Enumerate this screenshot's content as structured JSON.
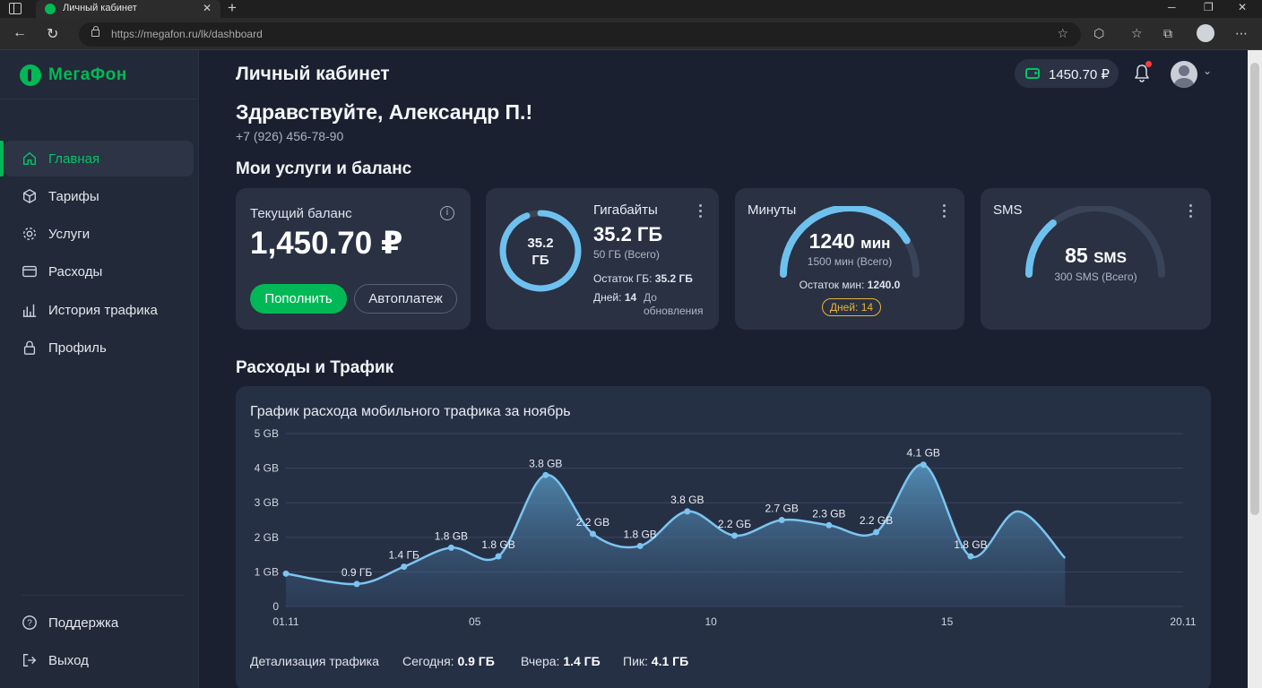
{
  "browser": {
    "tab_title": "Личный кабинет",
    "url": "https://megafon.ru/lk/dashboard"
  },
  "sidebar": {
    "logo": "МегаФон",
    "items": [
      {
        "label": "Главная",
        "icon": "home-icon",
        "active": true
      },
      {
        "label": "Тарифы",
        "icon": "box-icon"
      },
      {
        "label": "Услуги",
        "icon": "gear-icon"
      },
      {
        "label": "Расходы",
        "icon": "card-icon"
      },
      {
        "label": "История трафика",
        "icon": "bar-chart-icon"
      },
      {
        "label": "Профиль",
        "icon": "lock-icon"
      }
    ],
    "bottom_items": [
      {
        "label": "Поддержка",
        "icon": "help-icon"
      },
      {
        "label": "Выход",
        "icon": "logout-icon"
      }
    ]
  },
  "header": {
    "title": "Личный кабинет",
    "balance_chip": "1450.70 ₽"
  },
  "greeting": {
    "text": "Здравствуйте, Александр П.!",
    "phone": "+7 (926) 456-78-90"
  },
  "services_title": "Мои услуги и баланс",
  "balance_card": {
    "label": "Текущий баланс",
    "value": "1,450.70 ₽",
    "topup_button": "Пополнить",
    "autopay_button": "Автоплатеж"
  },
  "gb_card": {
    "ring_value": "35.2",
    "ring_unit": "ГБ",
    "fraction": 0.94,
    "title": "Гигабайты",
    "value": "35.2 ГБ",
    "total": "50 ГБ (Всего)",
    "rest_label": "Остаток ГБ:",
    "rest_value": "35.2 ГБ",
    "days_label": "Дней:",
    "days_value": "14",
    "days_note": "До обновления"
  },
  "minutes_card": {
    "title": "Минуты",
    "value_num": "1240",
    "value_unit": "мин",
    "total": "1500 мин (Всего)",
    "fraction": 0.83,
    "rest_label": "Остаток мин:",
    "rest_value": "1240.0",
    "days_pill": "Дней: 14"
  },
  "sms_card": {
    "title": "SMS",
    "value_num": "85",
    "value_unit": "SMS",
    "total": "300 SMS (Всего)",
    "fraction": 0.28
  },
  "traffic_title": "Расходы и Трафик",
  "chart_data": {
    "type": "area",
    "title": "График расхода мобильного трафика за ноябрь",
    "x_ticks": [
      "01.11",
      "05",
      "10",
      "15",
      "20.11"
    ],
    "y_ticks": [
      "0",
      "1 GB",
      "2 GB",
      "3 GB",
      "4 GB",
      "5 GB"
    ],
    "ylim": [
      0,
      5
    ],
    "xlim": [
      1,
      20
    ],
    "grid": true,
    "x": [
      1,
      2,
      3,
      4,
      5,
      6,
      7,
      8,
      9,
      10,
      11,
      12,
      13,
      14,
      15,
      16,
      17,
      18,
      19,
      20
    ],
    "values": [
      0.95,
      0.65,
      1.15,
      1.7,
      1.45,
      3.8,
      2.1,
      1.75,
      2.75,
      2.05,
      2.5,
      2.35,
      2.15,
      4.1,
      1.45,
      2.75,
      1.4
    ],
    "points_x": [
      1,
      2.5,
      3.5,
      4.5,
      5.5,
      6.5,
      7.5,
      8.5,
      9.5,
      10.5,
      11.5,
      12.5,
      13.5,
      14.5,
      15.5,
      16.5,
      17.5
    ],
    "labels": [
      {
        "x": 2.5,
        "y": 0.65,
        "text": "0.9 ГБ"
      },
      {
        "x": 3.5,
        "y": 1.15,
        "text": "1.4 ГБ"
      },
      {
        "x": 4.5,
        "y": 1.7,
        "text": "1.8 GB"
      },
      {
        "x": 5.5,
        "y": 1.45,
        "text": "1.8 GB"
      },
      {
        "x": 6.5,
        "y": 3.8,
        "text": "3.8 GB"
      },
      {
        "x": 7.5,
        "y": 2.1,
        "text": "2.2 GB"
      },
      {
        "x": 8.5,
        "y": 1.75,
        "text": "1.8 GB"
      },
      {
        "x": 9.5,
        "y": 2.75,
        "text": "3.8 GB"
      },
      {
        "x": 10.5,
        "y": 2.05,
        "text": "2.2 GБ"
      },
      {
        "x": 11.5,
        "y": 2.5,
        "text": "2.7 GB"
      },
      {
        "x": 12.5,
        "y": 2.35,
        "text": "2.3 GB"
      },
      {
        "x": 13.5,
        "y": 2.15,
        "text": "2.2 GB"
      },
      {
        "x": 14.5,
        "y": 4.1,
        "text": "4.1 GB"
      },
      {
        "x": 15.5,
        "y": 1.45,
        "text": "1.8 GB"
      }
    ],
    "color": "#7cc4f0"
  },
  "traffic_footer": {
    "details": "Детализация трафика",
    "today_label": "Сегодня:",
    "today_value": "0.9 ГБ",
    "yesterday_label": "Вчера:",
    "yesterday_value": "1.4 ГБ",
    "peak_label": "Пик:",
    "peak_value": "4.1 ГБ"
  },
  "colors": {
    "accent": "#00b956",
    "ring": "#6ec1ee",
    "ring_track": "#3a4459",
    "warning": "#e8b53a"
  }
}
